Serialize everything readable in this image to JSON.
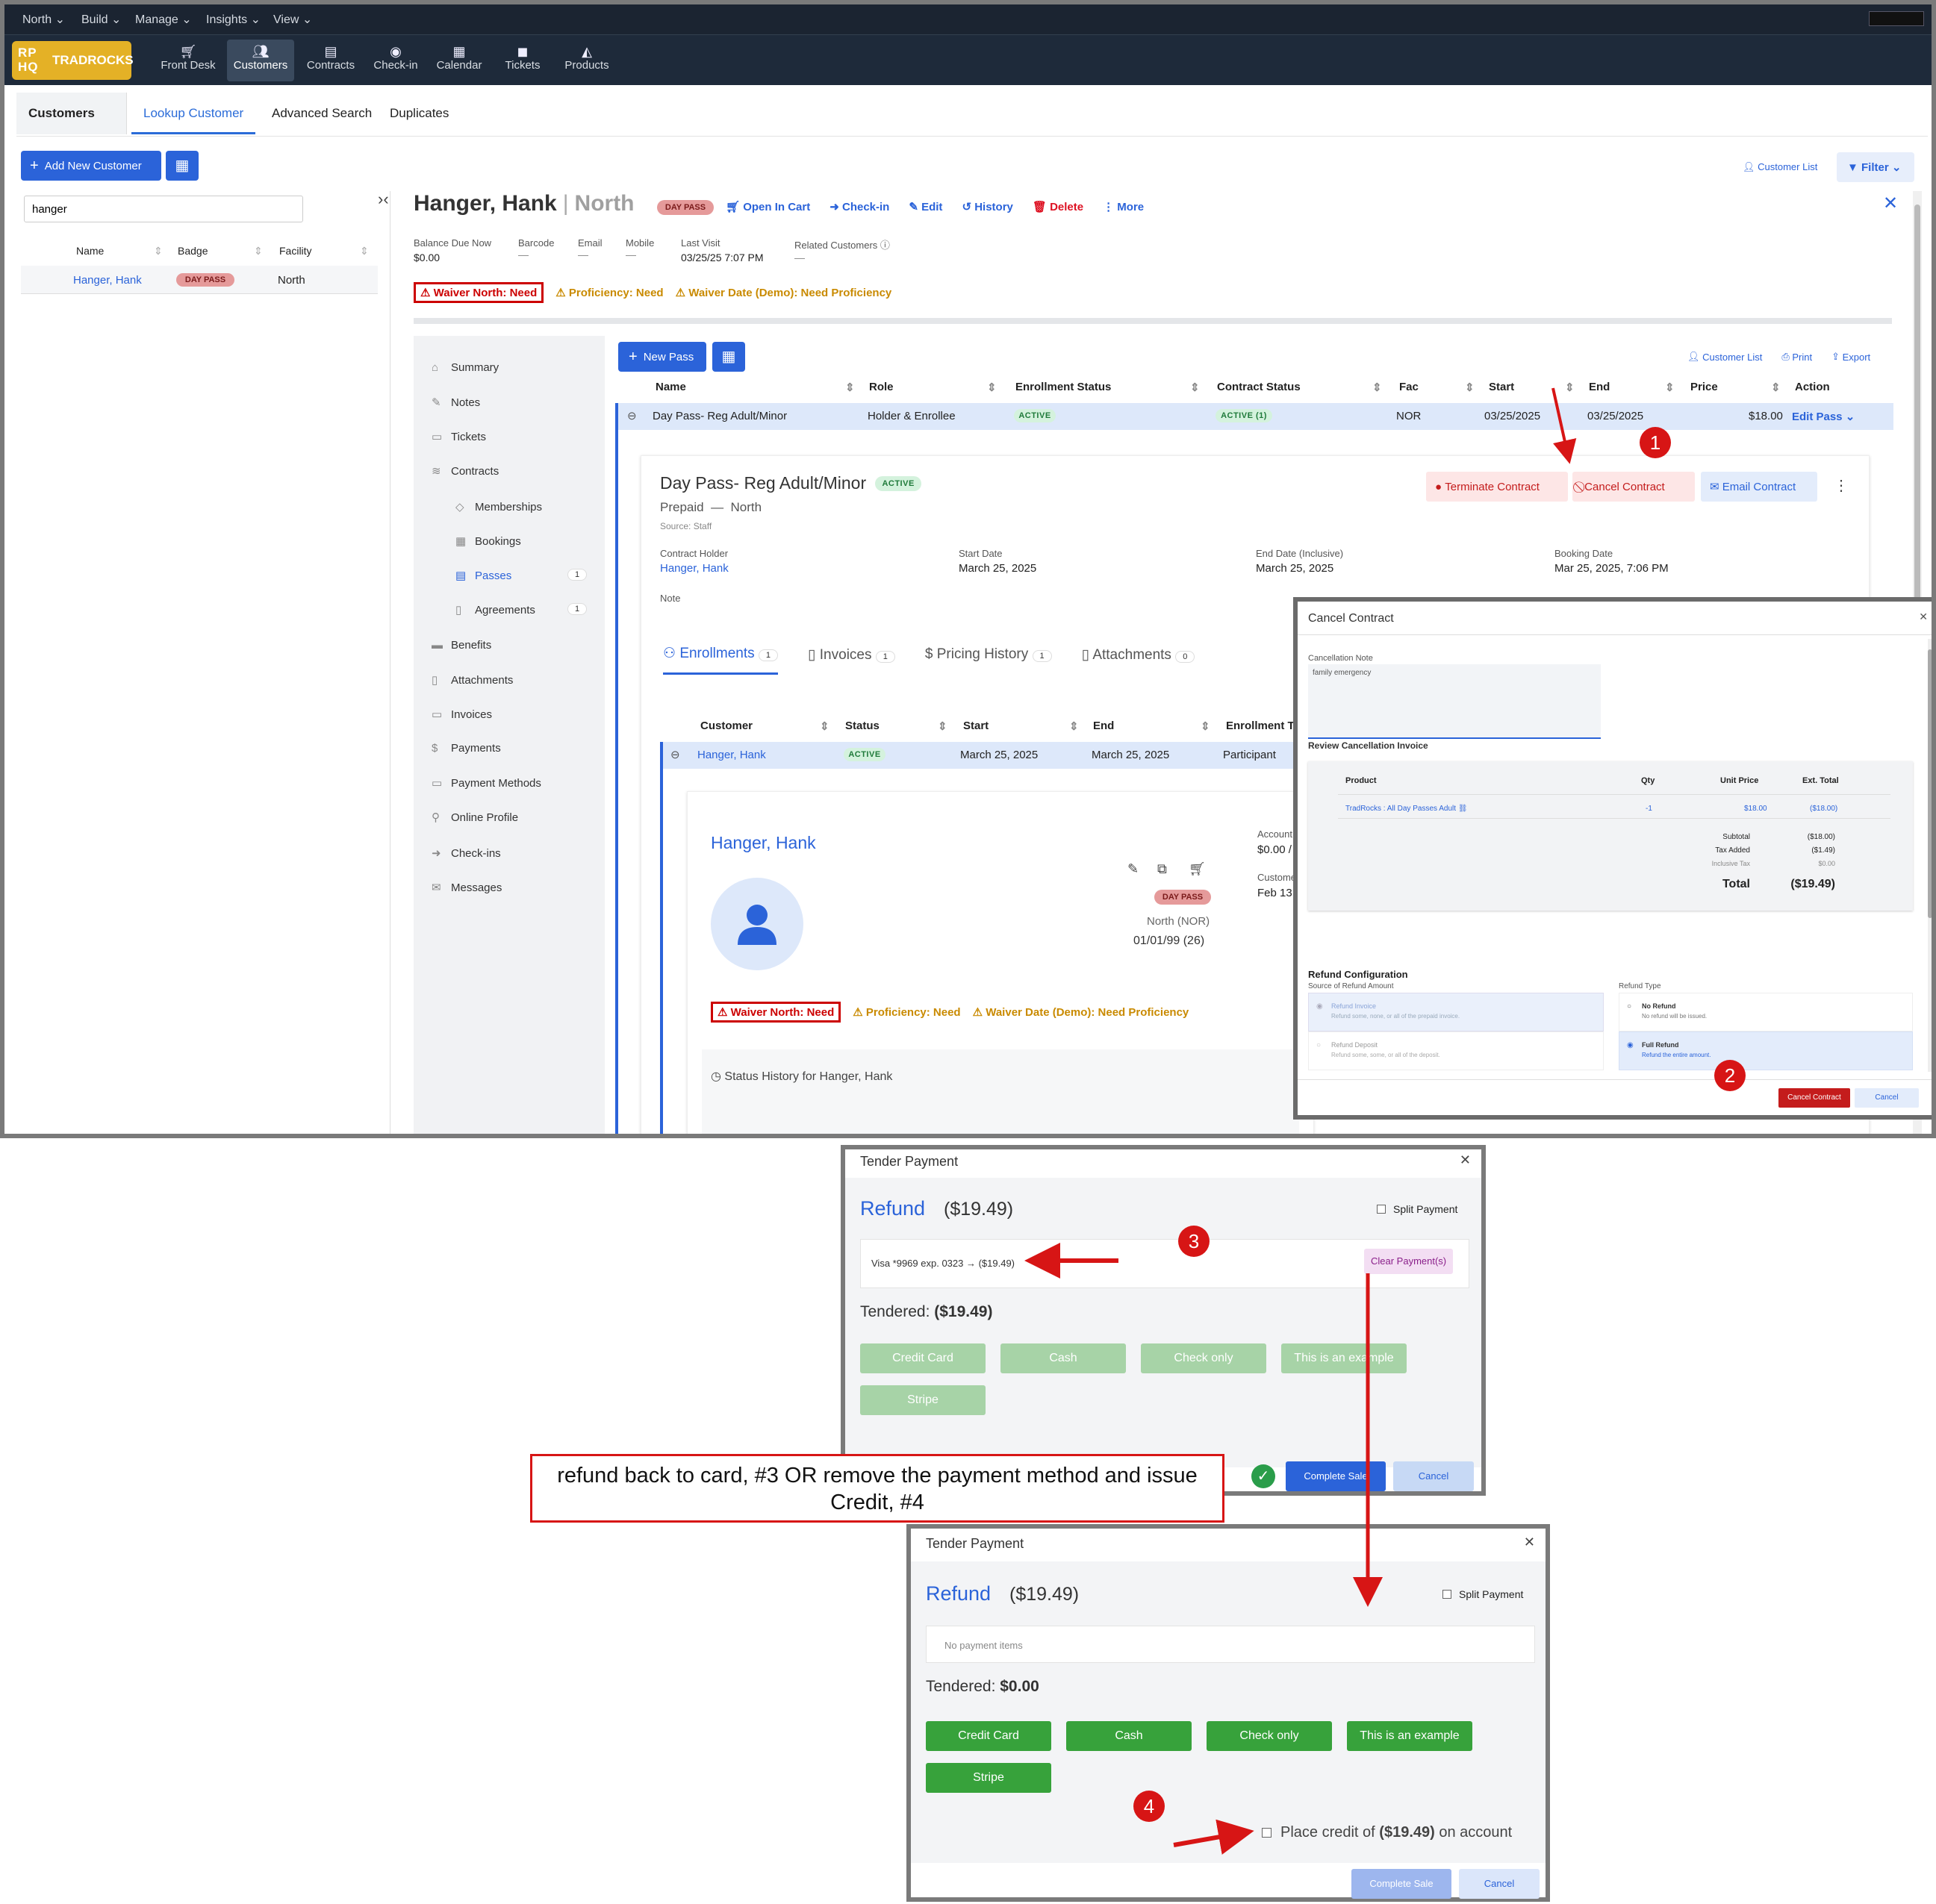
{
  "menubar": {
    "items": [
      "North",
      "Build",
      "Manage",
      "Insights",
      "View"
    ]
  },
  "logo": {
    "mark": "RP\nHQ",
    "name": "TRADROCKS"
  },
  "appnav": [
    {
      "label": "Front Desk",
      "icon": "cart-icon"
    },
    {
      "label": "Customers",
      "icon": "users-icon"
    },
    {
      "label": "Contracts",
      "icon": "contracts-icon"
    },
    {
      "label": "Check-in",
      "icon": "checkin-icon"
    },
    {
      "label": "Calendar",
      "icon": "calendar-icon"
    },
    {
      "label": "Tickets",
      "icon": "ticket-icon"
    },
    {
      "label": "Products",
      "icon": "products-icon"
    }
  ],
  "subtabs": {
    "customers": "Customers",
    "lookup": "Lookup Customer",
    "advanced": "Advanced Search",
    "duplicates": "Duplicates"
  },
  "left": {
    "add_button": "Add New Customer",
    "search_value": "hanger",
    "cols": [
      "Name",
      "Badge",
      "Facility"
    ],
    "row": {
      "name": "Hanger, Hank",
      "badge": "DAY PASS",
      "facility": "North"
    }
  },
  "topright": {
    "customer_list": "Customer List",
    "filter": "Filter"
  },
  "customer": {
    "name": "Hanger, Hank",
    "sep": "|",
    "facility": "North",
    "badge": "DAY PASS",
    "actions": [
      "Open In Cart",
      "Check-in",
      "Edit",
      "History",
      "Delete",
      "More"
    ],
    "fields": [
      {
        "label": "Balance Due Now",
        "value": "$0.00"
      },
      {
        "label": "Barcode",
        "value": "—"
      },
      {
        "label": "Email",
        "value": "—"
      },
      {
        "label": "Mobile",
        "value": "—"
      },
      {
        "label": "Last Visit",
        "value": "03/25/25 7:07 PM"
      },
      {
        "label": "Related Customers",
        "value": "—"
      }
    ],
    "alerts": {
      "waiver": "Waiver North: Need",
      "proficiency": "Proficiency: Need",
      "waiver_date": "Waiver Date (Demo): Need Proficiency"
    }
  },
  "sidebar": {
    "items": [
      {
        "label": "Summary",
        "icon": "home-icon"
      },
      {
        "label": "Notes",
        "icon": "notes-icon"
      },
      {
        "label": "Tickets",
        "icon": "ticket-icon"
      },
      {
        "label": "Contracts",
        "icon": "layers-icon"
      },
      {
        "label": "Memberships",
        "icon": "tag-icon"
      },
      {
        "label": "Bookings",
        "icon": "calendar-icon"
      },
      {
        "label": "Passes",
        "icon": "pass-icon",
        "count": "1"
      },
      {
        "label": "Agreements",
        "icon": "document-icon",
        "count": "1"
      },
      {
        "label": "Benefits",
        "icon": "benefits-icon"
      },
      {
        "label": "Attachments",
        "icon": "attachment-icon"
      },
      {
        "label": "Invoices",
        "icon": "invoice-icon"
      },
      {
        "label": "Payments",
        "icon": "dollar-icon"
      },
      {
        "label": "Payment Methods",
        "icon": "card-icon"
      },
      {
        "label": "Online Profile",
        "icon": "person-icon"
      },
      {
        "label": "Check-ins",
        "icon": "checkin-icon"
      },
      {
        "label": "Messages",
        "icon": "mail-icon"
      }
    ]
  },
  "passes": {
    "new_pass": "New Pass",
    "links": {
      "customer_list": "Customer List",
      "print": "Print",
      "export": "Export"
    },
    "cols": [
      "Name",
      "Role",
      "Enrollment Status",
      "Contract Status",
      "Fac",
      "Start",
      "End",
      "Price",
      "Action"
    ],
    "row": {
      "name": "Day Pass- Reg Adult/Minor",
      "role": "Holder & Enrollee",
      "enrollment": "ACTIVE",
      "contract": "ACTIVE (1)",
      "fac": "NOR",
      "start": "03/25/2025",
      "end": "03/25/2025",
      "price": "$18.00",
      "action": "Edit Pass"
    }
  },
  "contract": {
    "title": "Day Pass- Reg Adult/Minor",
    "status": "ACTIVE",
    "prepaid": "Prepaid",
    "dash": "—",
    "facility": "North",
    "source": "Source: Staff",
    "buttons": {
      "terminate": "Terminate Contract",
      "cancel": "Cancel Contract",
      "email": "Email Contract"
    },
    "fields": [
      {
        "label": "Contract Holder",
        "value": "Hanger, Hank"
      },
      {
        "label": "Start Date",
        "value": "March 25, 2025"
      },
      {
        "label": "End Date (Inclusive)",
        "value": "March 25, 2025"
      },
      {
        "label": "Booking Date",
        "value": "Mar 25, 2025, 7:06 PM"
      }
    ],
    "note_label": "Note",
    "tabs": [
      {
        "label": "Enrollments",
        "count": "1"
      },
      {
        "label": "Invoices",
        "count": "1"
      },
      {
        "label": "Pricing History",
        "count": "1"
      },
      {
        "label": "Attachments",
        "count": "0"
      }
    ],
    "enr_cols": [
      "Customer",
      "Status",
      "Start",
      "End",
      "Enrollment Ty"
    ],
    "enr_row": {
      "customer": "Hanger, Hank",
      "status": "ACTIVE",
      "start": "March 25, 2025",
      "end": "March 25, 2025",
      "type": "Participant"
    }
  },
  "card": {
    "name": "Hanger, Hank",
    "badge": "DAY PASS",
    "facility": "North (NOR)",
    "dob": "01/01/99 (26)",
    "account_label": "Account",
    "account_value": "$0.00 /",
    "customer_label": "Custome",
    "customer_value": "Feb 13,",
    "status_history": "Status History for Hanger, Hank"
  },
  "cancel_modal": {
    "title": "Cancel Contract",
    "note_label": "Cancellation Note",
    "note_value": "family emergency",
    "review_label": "Review Cancellation Invoice",
    "cols": [
      "Product",
      "Qty",
      "Unit Price",
      "Ext. Total"
    ],
    "row": {
      "product": "TradRocks : All Day Passes Adult",
      "qty": "-1",
      "unit": "$18.00",
      "ext": "($18.00)"
    },
    "totals": [
      {
        "label": "Subtotal",
        "value": "($18.00)"
      },
      {
        "label": "Tax Added",
        "value": "($1.49)"
      },
      {
        "label": "Inclusive Tax",
        "value": "$0.00"
      }
    ],
    "total_label": "Total",
    "total_value": "($19.49)",
    "refund_config": "Refund Configuration",
    "source_label": "Source of Refund Amount",
    "sources": [
      {
        "title": "Refund Invoice",
        "desc": "Refund some, none, or all of the prepaid invoice."
      },
      {
        "title": "Refund Deposit",
        "desc": "Refund some, some, or all of the deposit."
      }
    ],
    "type_label": "Refund Type",
    "types": [
      {
        "title": "No Refund",
        "desc": "No refund will be issued."
      },
      {
        "title": "Full Refund",
        "desc": "Refund the entire amount."
      }
    ],
    "confirm": "Cancel Contract",
    "cancel": "Cancel"
  },
  "tender1": {
    "title": "Tender Payment",
    "refund": "Refund",
    "amount": "($19.49)",
    "split": "Split Payment",
    "payment_item": "Visa *9969 exp. 0323 → ($19.49)",
    "clear": "Clear Payment(s)",
    "tendered_label": "Tendered:",
    "tendered_value": "($19.49)",
    "methods": [
      "Credit Card",
      "Cash",
      "Check only",
      "This is an example",
      "Stripe"
    ],
    "complete": "Complete Sale",
    "cancel": "Cancel"
  },
  "tender2": {
    "title": "Tender Payment",
    "refund": "Refund",
    "amount": "($19.49)",
    "split": "Split Payment",
    "no_items": "No payment items",
    "tendered_label": "Tendered:",
    "tendered_value": "$0.00",
    "methods": [
      "Credit Card",
      "Cash",
      "Check only",
      "This is an example",
      "Stripe"
    ],
    "credit_pre": "Place credit of",
    "credit_amt": "($19.49)",
    "credit_post": "on account",
    "complete": "Complete Sale",
    "cancel": "Cancel"
  },
  "annotations": {
    "callout": "refund back to card, #3 OR remove the payment method and issue Credit, #4",
    "n1": "1",
    "n2": "2",
    "n3": "3",
    "n4": "4"
  }
}
